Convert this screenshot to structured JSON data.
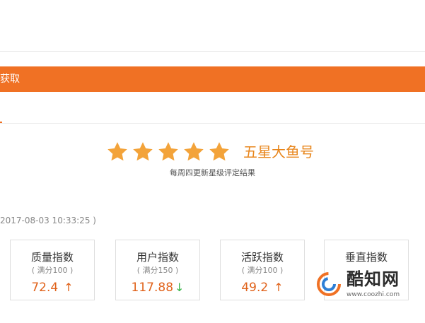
{
  "colors": {
    "accent": "#f07124",
    "star": "#f3a33a",
    "rating_text": "#e8861c",
    "value_text": "#e0621a",
    "arrow_down": "#39b54a"
  },
  "banner": {
    "label": "获取"
  },
  "rating": {
    "stars": 5,
    "max_stars": 5,
    "star_icon": "star-icon",
    "label": "五星大鱼号",
    "note": "每周四更新星级评定结果"
  },
  "timestamp": "2017-08-03 10:33:25 )",
  "cards": [
    {
      "title": "质量指数",
      "max": "( 满分100 )",
      "value": "72.4",
      "trend": "↑",
      "trend_dir": "up"
    },
    {
      "title": "用户指数",
      "max": "( 满分150 )",
      "value": "117.88",
      "trend": "↓",
      "trend_dir": "down"
    },
    {
      "title": "活跃指数",
      "max": "( 满分100 )",
      "value": "49.2",
      "trend": "↑",
      "trend_dir": "up"
    },
    {
      "title": "垂直指数",
      "max": "",
      "value": "",
      "trend": "",
      "trend_dir": ""
    }
  ],
  "watermark": {
    "logo_icon": "coozhi-logo-icon",
    "name": "酷知网",
    "url": "www.coozhi.com"
  }
}
